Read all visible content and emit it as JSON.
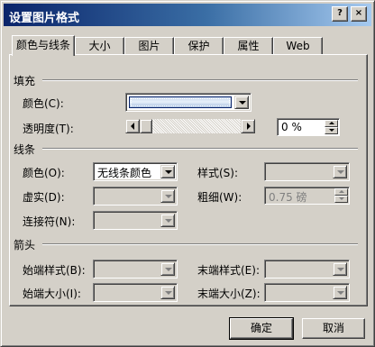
{
  "window": {
    "title": "设置图片格式",
    "help_label": "?",
    "close_label": "×"
  },
  "tabs": [
    "颜色与线条",
    "大小",
    "图片",
    "保护",
    "属性",
    "Web"
  ],
  "fill": {
    "section": "填充",
    "color_label": "颜色(C):",
    "color_value_description": "light blue gradient",
    "transparency_label": "透明度(T):",
    "transparency_value": "0 %"
  },
  "line": {
    "section": "线条",
    "color_label": "颜色(O):",
    "color_value": "无线条颜色",
    "dash_label": "虚实(D):",
    "connector_label": "连接符(N):",
    "style_label": "样式(S):",
    "weight_label": "粗细(W):",
    "weight_value": "0.75 磅"
  },
  "arrows": {
    "section": "箭头",
    "begin_style_label": "始端样式(B):",
    "begin_size_label": "始端大小(I):",
    "end_style_label": "末端样式(E):",
    "end_size_label": "末端大小(Z):"
  },
  "buttons": {
    "ok": "确定",
    "cancel": "取消"
  },
  "colors": {
    "titlebar_start": "#0a246a",
    "titlebar_end": "#a6caf0",
    "face": "#d4d0c8",
    "fill_swatch": "#c8d8ee"
  }
}
